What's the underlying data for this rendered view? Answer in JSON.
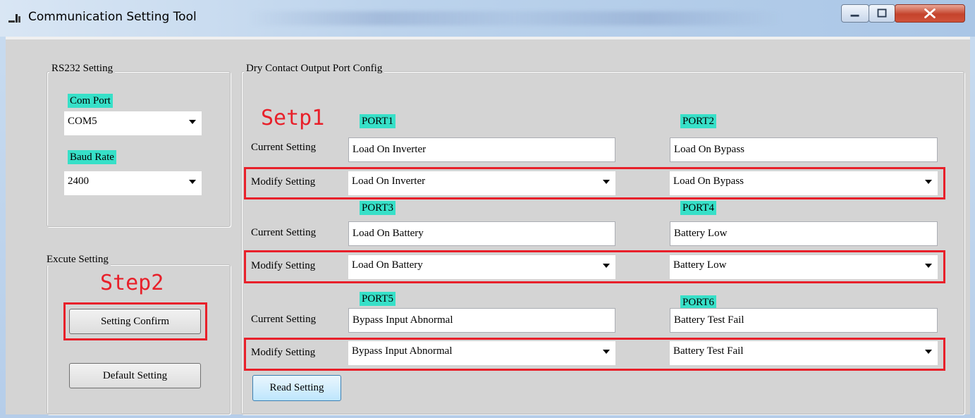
{
  "window": {
    "title": "Communication Setting Tool"
  },
  "rs232": {
    "group_title": "RS232 Setting",
    "com_port_label": "Com Port",
    "com_port_value": "COM5",
    "baud_rate_label": "Baud Rate",
    "baud_rate_value": "2400"
  },
  "execute": {
    "group_title": "Excute Setting",
    "step_label": "Step2",
    "confirm_label": "Setting Confirm",
    "default_label": "Default Setting"
  },
  "dry_contact": {
    "group_title": "Dry Contact Output Port Config",
    "step_label": "Setp1",
    "current_label": "Current Setting",
    "modify_label": "Modify Setting",
    "read_label": "Read Setting",
    "ports": [
      {
        "name": "PORT1",
        "current": "Load On Inverter",
        "modify": "Load On Inverter"
      },
      {
        "name": "PORT2",
        "current": "Load On Bypass",
        "modify": "Load On Bypass"
      },
      {
        "name": "PORT3",
        "current": "Load On Battery",
        "modify": "Load On Battery"
      },
      {
        "name": "PORT4",
        "current": "Battery Low",
        "modify": "Battery Low"
      },
      {
        "name": "PORT5",
        "current": "Bypass Input Abnormal",
        "modify": "Bypass Input Abnormal"
      },
      {
        "name": "PORT6",
        "current": "Battery Test Fail",
        "modify": "Battery Test Fail"
      }
    ]
  },
  "colors": {
    "highlight": "#37e0c8",
    "annotation": "#e8202a"
  }
}
